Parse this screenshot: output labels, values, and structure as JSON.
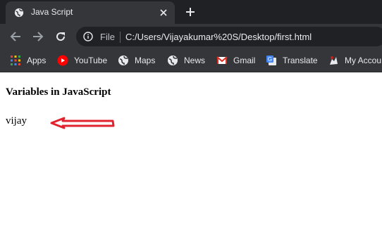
{
  "browser": {
    "tab": {
      "title": "Java Script",
      "favicon": "globe-icon",
      "close": "close-icon"
    },
    "new_tab": "plus-icon",
    "nav": {
      "back": "back-arrow-icon",
      "forward": "forward-arrow-icon",
      "reload": "reload-icon"
    },
    "omnibox": {
      "scheme": "File",
      "url": "C:/Users/Vijayakumar%20S/Desktop/first.html",
      "info_icon": "info-icon"
    },
    "bookmarks": [
      {
        "label": "Apps",
        "icon": "apps-grid-icon"
      },
      {
        "label": "YouTube",
        "icon": "youtube-icon"
      },
      {
        "label": "Maps",
        "icon": "globe-icon"
      },
      {
        "label": "News",
        "icon": "globe-icon"
      },
      {
        "label": "Gmail",
        "icon": "gmail-icon"
      },
      {
        "label": "Translate",
        "icon": "translate-icon"
      },
      {
        "label": "My Accou",
        "icon": "account-icon"
      }
    ]
  },
  "page": {
    "heading": "Variables in JavaScript",
    "output_value": "vijay",
    "annotation": "red-arrow-pointing-left"
  },
  "colors": {
    "arrow": "#e0232f",
    "chrome_dark": "#35363a",
    "tabstrip": "#202124"
  }
}
